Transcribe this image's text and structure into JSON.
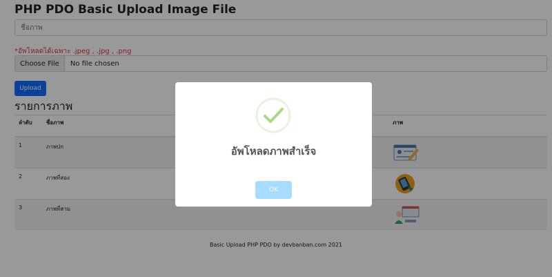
{
  "page": {
    "title": "PHP PDO Basic Upload Image File",
    "name_placeholder": "ชื่อภาพ",
    "file_note": "*อัพโหลดได้เฉพาะ .jpeg , .jpg , .png",
    "file_button": "Choose File",
    "file_status": "No file chosen",
    "upload_button": "Upload",
    "list_title": "รายการภาพ",
    "table": {
      "headers": [
        "ลำดับ",
        "ชื่อภาพ",
        "ภาพ"
      ],
      "rows": [
        {
          "index": "1",
          "name": "ภาพปก",
          "image_icon": "document-pencil-icon"
        },
        {
          "index": "2",
          "name": "ภาพที่สอง",
          "image_icon": "phone-icon"
        },
        {
          "index": "3",
          "name": "ภาพที่สาม",
          "image_icon": "person-desk-icon"
        }
      ]
    },
    "footer": "Basic Upload PHP PDO by devbanban.com 2021"
  },
  "modal": {
    "icon": "success-check-icon",
    "title": "อัพโหลดภาพสำเร็จ",
    "ok_button": "OK"
  },
  "colors": {
    "primary": "#0d6efd",
    "danger": "#dc3545",
    "success": "#a5dc86",
    "ok_button": "#a5dcff"
  }
}
